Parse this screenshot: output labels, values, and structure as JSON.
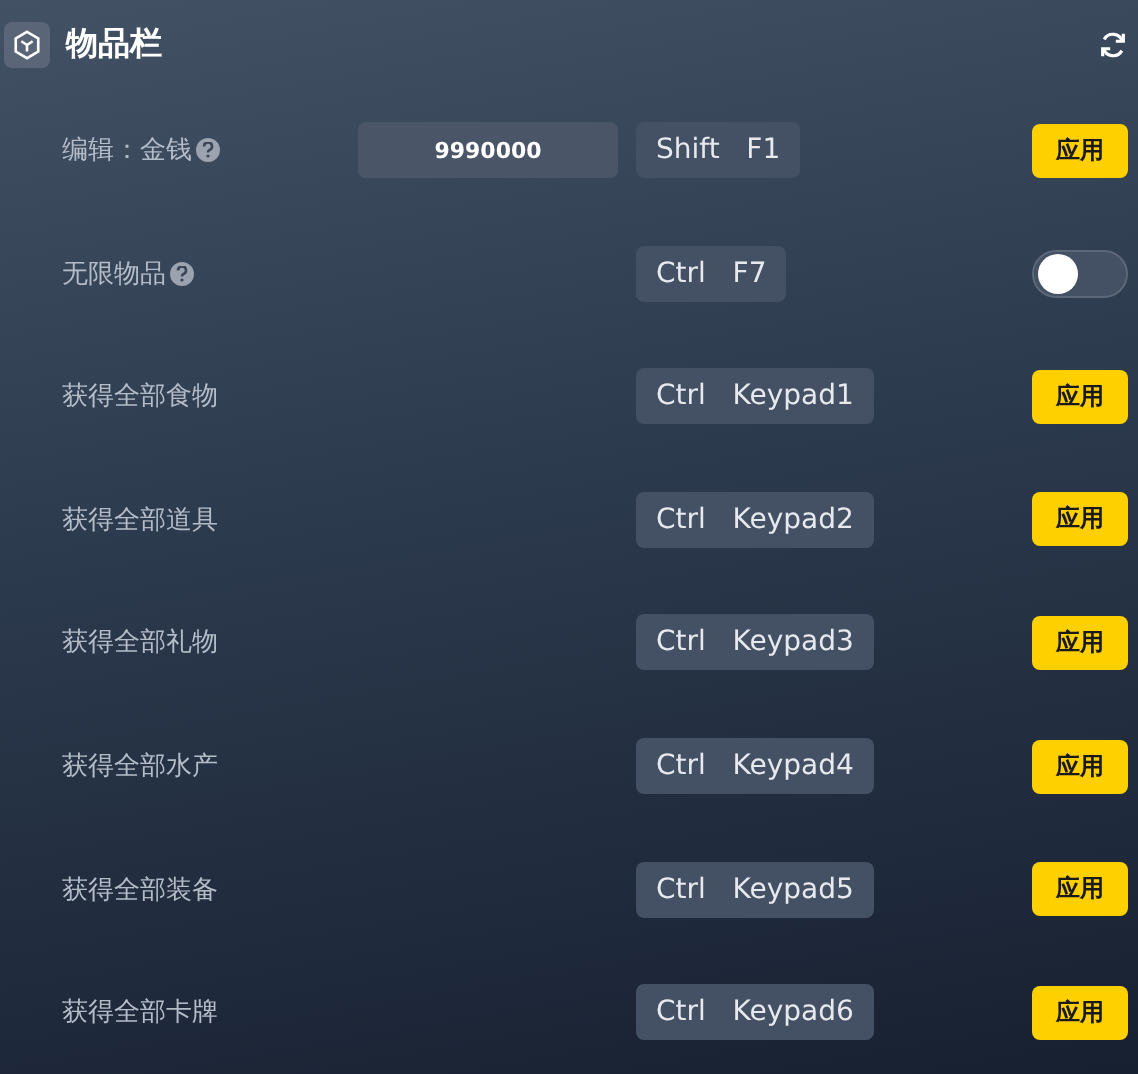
{
  "header": {
    "title": "物品栏"
  },
  "rows": [
    {
      "kind": "input",
      "label": "编辑：金钱",
      "help": true,
      "value": "9990000",
      "keys": [
        "Shift",
        "F1"
      ],
      "button": "应用"
    },
    {
      "kind": "toggle",
      "label": "无限物品",
      "help": true,
      "keys": [
        "Ctrl",
        "F7"
      ],
      "on": false
    },
    {
      "kind": "action",
      "label": "获得全部食物",
      "help": false,
      "keys": [
        "Ctrl",
        "Keypad1"
      ],
      "button": "应用"
    },
    {
      "kind": "action",
      "label": "获得全部道具",
      "help": false,
      "keys": [
        "Ctrl",
        "Keypad2"
      ],
      "button": "应用"
    },
    {
      "kind": "action",
      "label": "获得全部礼物",
      "help": false,
      "keys": [
        "Ctrl",
        "Keypad3"
      ],
      "button": "应用"
    },
    {
      "kind": "action",
      "label": "获得全部水产",
      "help": false,
      "keys": [
        "Ctrl",
        "Keypad4"
      ],
      "button": "应用"
    },
    {
      "kind": "action",
      "label": "获得全部装备",
      "help": false,
      "keys": [
        "Ctrl",
        "Keypad5"
      ],
      "button": "应用"
    },
    {
      "kind": "action",
      "label": "获得全部卡牌",
      "help": false,
      "keys": [
        "Ctrl",
        "Keypad6"
      ],
      "button": "应用"
    }
  ]
}
